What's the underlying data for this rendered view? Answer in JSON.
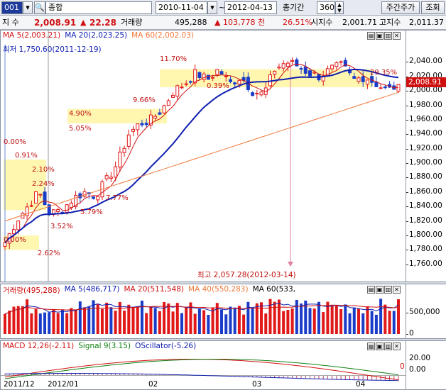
{
  "toolbar": {
    "code": "001",
    "search_icon": "magnifier-icon",
    "name": "종합",
    "date_from": "2010-11-04",
    "date_to": "2012-04-13",
    "period_label": "총기간",
    "period_value": "360",
    "weekly_button": "주간주가",
    "query_button": "조회"
  },
  "info": {
    "index_label": "지 수",
    "index_value": "2,008.91",
    "change_arrow": "▲",
    "change": "22.28",
    "volume_label": "거래량",
    "volume": "495,288",
    "volume_change_arrow": "▲",
    "volume_change": "103,778 천",
    "change_pct": "26.51%",
    "open_label": "시지수",
    "open_value": "2,001.71",
    "high_label": "고지수",
    "high_value": "2,011.37"
  },
  "colors": {
    "up": "#e01818",
    "down": "#1a3cc8",
    "ma5": "#d01010",
    "ma20": "#1020b0",
    "ma60": "#f07838",
    "highlight": "#fff6b0"
  },
  "price_panel": {
    "legend": [
      {
        "text": "MA 5(2,003.21)",
        "color": "#d01010"
      },
      {
        "text": "MA 20(2,023.25)",
        "color": "#1020b0"
      },
      {
        "text": "MA 60(2,002.03)",
        "color": "#f07838"
      }
    ],
    "low_note": "최저 1,750.60(2011-12-19)",
    "high_note": "최고 2,057.28(2012-03-14)",
    "current_price_tag": "2,008.91",
    "pct_labels": [
      "11.70%",
      "0.39%",
      "9.66%",
      "4.90%",
      "5.05%",
      "0.00%",
      "0.91%",
      "2.10%",
      "2.24%",
      "7.77%",
      "5.79%",
      "3.52%",
      "0.00%",
      "2.62%",
      "29.35%"
    ],
    "y_ticks": [
      "2,040.00",
      "2,020.00",
      "2,000.00",
      "1,980.00",
      "1,960.00",
      "1,940.00",
      "1,920.00",
      "1,900.00",
      "1,880.00",
      "1,860.00",
      "1,840.00",
      "1,820.00",
      "1,800.00",
      "1,780.00",
      "1,760.00"
    ]
  },
  "volume_panel": {
    "legend": [
      {
        "text": "거래량(495,288)",
        "color": "#d01010"
      },
      {
        "text": "MA 5(486,717)",
        "color": "#1020b0"
      },
      {
        "text": "MA 20(511,548)",
        "color": "#d01010"
      },
      {
        "text": "MA 40(550,283)",
        "color": "#f07838"
      },
      {
        "text": "MA 60(533,",
        "color": "#000000"
      }
    ],
    "y_ticks": [
      "500,000",
      "0"
    ]
  },
  "macd_panel": {
    "legend": [
      {
        "text": "MACD 12,26(-2.11)",
        "color": "#d01010"
      },
      {
        "text": "Signal 9(3.15)",
        "color": "#108010"
      },
      {
        "text": "OScillator(-5.26)",
        "color": "#1020b0"
      }
    ],
    "y_ticks": [
      "20.00",
      "0.00"
    ],
    "zero_marker": "0"
  },
  "x_axis": [
    "2011/12",
    "2012/01",
    "02",
    "03",
    "04"
  ],
  "win_controls": [
    "▤",
    "▣",
    "▥",
    "✕"
  ],
  "chart_data": {
    "type": "candlestick",
    "title": "",
    "xlabel": "",
    "ylabel": "",
    "ylim": [
      1750,
      2060
    ],
    "period": [
      "2011-12-01",
      "2012-04-13"
    ],
    "approx_close_path": [
      1790,
      1820,
      1840,
      1860,
      1830,
      1835,
      1850,
      1860,
      1855,
      1875,
      1900,
      1940,
      1955,
      1960,
      1975,
      2000,
      2010,
      2025,
      2015,
      2030,
      2010,
      2020,
      2000,
      1995,
      2030,
      2040,
      2035,
      2025,
      2020,
      2030,
      2035,
      2015,
      2020,
      2010,
      2000,
      2008.91
    ],
    "series": [
      {
        "name": "MA 5",
        "last": 2003.21
      },
      {
        "name": "MA 20",
        "last": 2023.25
      },
      {
        "name": "MA 60",
        "last": 2002.03
      }
    ],
    "volume_ylim": [
      0,
      700000
    ],
    "macd_ylim": [
      -10,
      30
    ]
  }
}
